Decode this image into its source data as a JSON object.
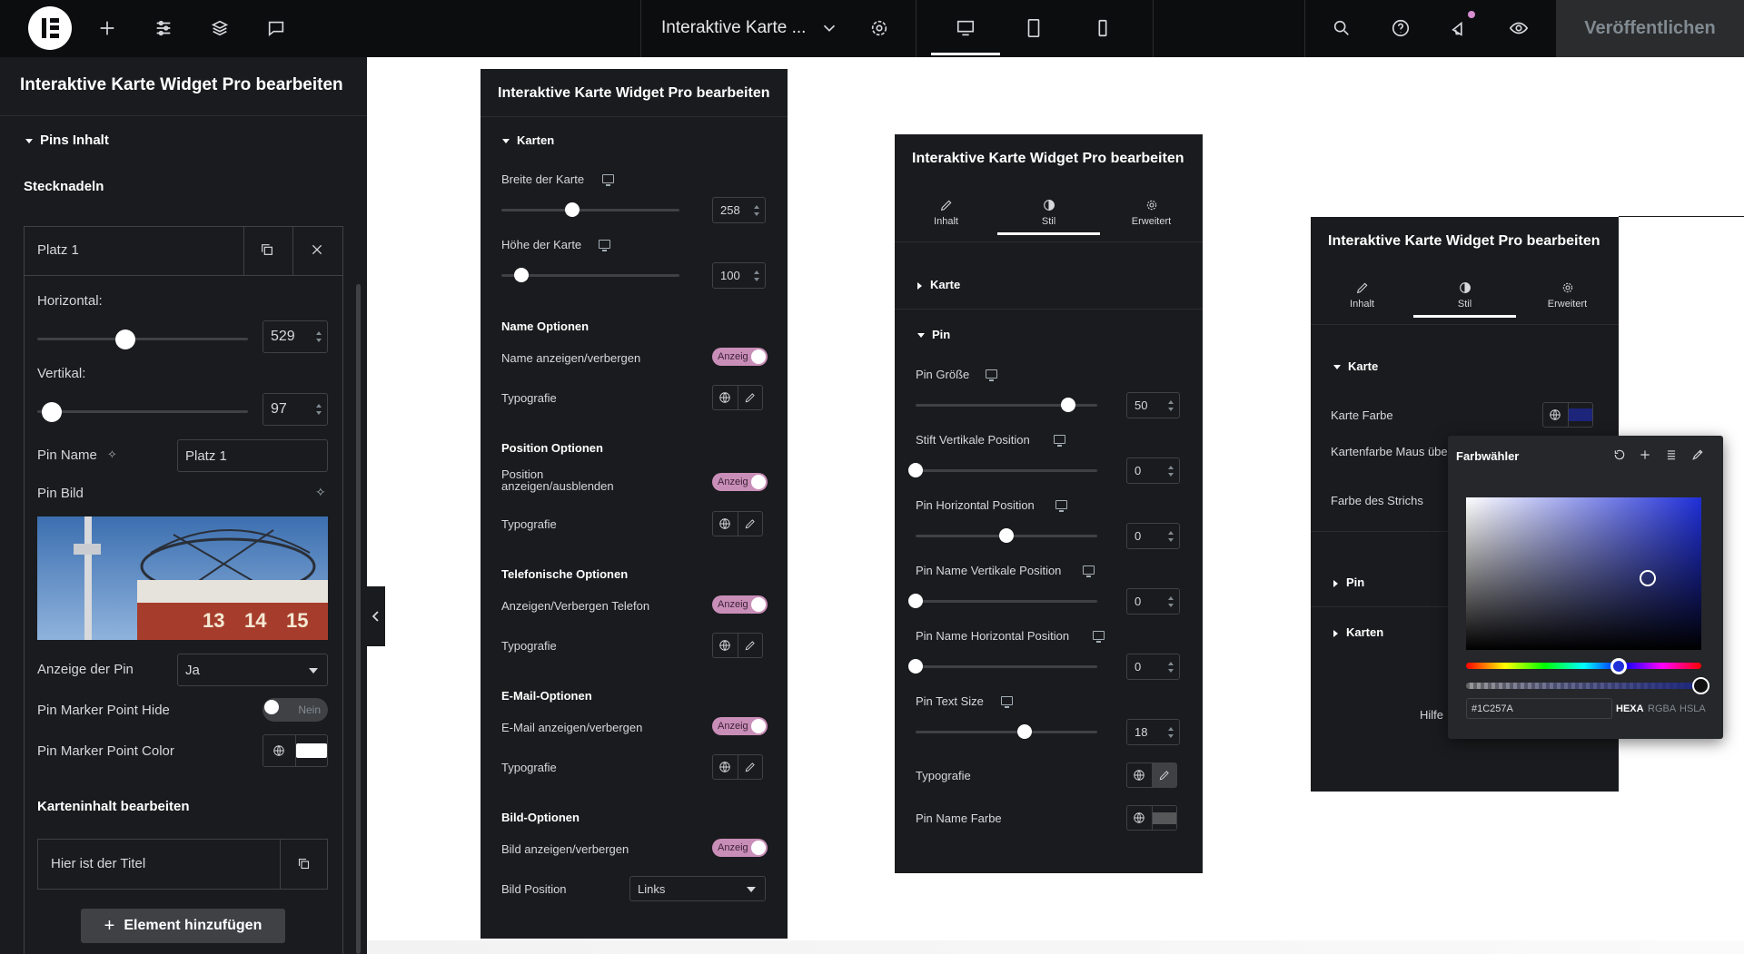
{
  "topbar": {
    "document_title": "Interaktive Karte ...",
    "publish_label": "Veröffentlichen"
  },
  "sidebar": {
    "title": "Interaktive Karte Widget Pro bearbeiten",
    "section": "Pins Inhalt",
    "subheading": "Stecknadeln",
    "pin_item_label": "Platz 1",
    "horizontal_label": "Horizontal:",
    "horizontal_value": "529",
    "horizontal_fraction": 0.42,
    "vertical_label": "Vertikal:",
    "vertical_value": "97",
    "vertical_fraction": 0.07,
    "pin_name_label": "Pin Name",
    "pin_name_value": "Platz 1",
    "pin_image_label": "Pin Bild",
    "pin_display_label": "Anzeige der Pin",
    "pin_display_value": "Ja",
    "marker_hide_label": "Pin Marker Point Hide",
    "marker_hide_toggle": "Nein",
    "marker_color_label": "Pin Marker Point Color",
    "map_content_heading": "Karteninhalt bearbeiten",
    "content_item_label": "Hier ist der Titel",
    "add_element_label": "Element hinzufügen",
    "clock_numbers": [
      "13",
      "14",
      "15"
    ]
  },
  "panel2": {
    "title": "Interaktive Karte Widget Pro bearbeiten",
    "section": "Karten",
    "width_label": "Breite der Karte",
    "width_value": "258",
    "width_fraction": 0.4,
    "height_label": "Höhe der Karte",
    "height_value": "100",
    "height_fraction": 0.11,
    "name_options": "Name Optionen",
    "name_toggle_label": "Name anzeigen/verbergen",
    "typography": "Typografie",
    "position_options": "Position Optionen",
    "position_toggle_label": "Position anzeigen/ausblenden",
    "phone_options": "Telefonische Optionen",
    "phone_toggle_label": "Anzeigen/Verbergen Telefon",
    "email_options": "E-Mail-Optionen",
    "email_toggle_label": "E-Mail anzeigen/verbergen",
    "image_options": "Bild-Optionen",
    "image_toggle_label": "Bild anzeigen/verbergen",
    "image_position_label": "Bild Position",
    "image_position_value": "Links",
    "toggle_on": "Anzeig"
  },
  "panel3": {
    "title": "Interaktive Karte Widget Pro bearbeiten",
    "tabs": [
      "Inhalt",
      "Stil",
      "Erweitert"
    ],
    "section_karte": "Karte",
    "section_pin": "Pin",
    "pin_size_label": "Pin Größe",
    "pin_size_value": "50",
    "pin_size_fraction": 0.84,
    "stift_vertical_label": "Stift Vertikale Position",
    "stift_vertical_value": "0",
    "stift_vertical_fraction": 0.0,
    "pin_horizontal_label": "Pin Horizontal Position",
    "pin_horizontal_value": "0",
    "pin_horizontal_fraction": 0.5,
    "name_vertical_label": "Pin Name Vertikale Position",
    "name_vertical_value": "0",
    "name_vertical_fraction": 0.0,
    "name_horizontal_label": "Pin Name Horizontal Position",
    "name_horizontal_value": "0",
    "name_horizontal_fraction": 0.0,
    "text_size_label": "Pin Text Size",
    "text_size_value": "18",
    "text_size_fraction": 0.6,
    "typography": "Typografie",
    "name_color_label": "Pin Name Farbe"
  },
  "panel4": {
    "title": "Interaktive Karte Widget Pro bearbeiten",
    "tabs": [
      "Inhalt",
      "Stil",
      "Erweitert"
    ],
    "section_karte": "Karte",
    "map_color_label": "Karte Farbe",
    "hover_color_label": "Kartenfarbe Maus über Region",
    "stroke_color_label": "Farbe des Strichs",
    "section_pin": "Pin",
    "section_karten": "Karten",
    "help_label": "Hilfe",
    "picker_title": "Farbwähler",
    "hex_value": "#1C257A",
    "modes": [
      "HEXA",
      "RGBA",
      "HSLA"
    ],
    "selected_color": "#1c257a",
    "hue_color": "#1f2fd8",
    "hue_fraction": 0.65
  },
  "colors": {
    "accent_toggle": "#c98eb8",
    "panel_bg": "#1a1b1e",
    "topbar_bg": "#0c0d0e"
  }
}
